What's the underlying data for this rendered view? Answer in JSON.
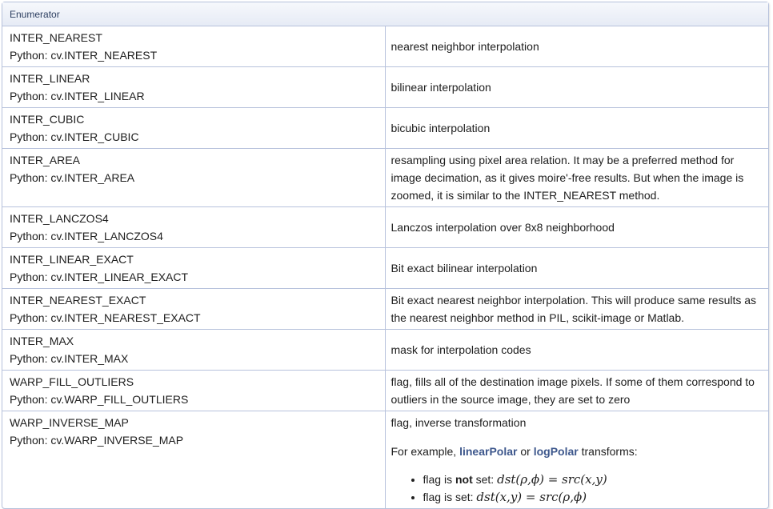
{
  "header": {
    "title": "Enumerator"
  },
  "rows": [
    {
      "name": "INTER_NEAREST",
      "python": "Python: cv.INTER_NEAREST",
      "desc": "nearest neighbor interpolation"
    },
    {
      "name": "INTER_LINEAR",
      "python": "Python: cv.INTER_LINEAR",
      "desc": "bilinear interpolation"
    },
    {
      "name": "INTER_CUBIC",
      "python": "Python: cv.INTER_CUBIC",
      "desc": "bicubic interpolation"
    },
    {
      "name": "INTER_AREA",
      "python": "Python: cv.INTER_AREA",
      "desc": "resampling using pixel area relation. It may be a preferred method for image decimation, as it gives moire'-free results. But when the image is zoomed, it is similar to the INTER_NEAREST method."
    },
    {
      "name": "INTER_LANCZOS4",
      "python": "Python: cv.INTER_LANCZOS4",
      "desc": "Lanczos interpolation over 8x8 neighborhood"
    },
    {
      "name": "INTER_LINEAR_EXACT",
      "python": "Python: cv.INTER_LINEAR_EXACT",
      "desc": "Bit exact bilinear interpolation"
    },
    {
      "name": "INTER_NEAREST_EXACT",
      "python": "Python: cv.INTER_NEAREST_EXACT",
      "desc": "Bit exact nearest neighbor interpolation. This will produce same results as the nearest neighbor method in PIL, scikit-image or Matlab."
    },
    {
      "name": "INTER_MAX",
      "python": "Python: cv.INTER_MAX",
      "desc": "mask for interpolation codes"
    },
    {
      "name": "WARP_FILL_OUTLIERS",
      "python": "Python: cv.WARP_FILL_OUTLIERS",
      "desc": "flag, fills all of the destination image pixels. If some of them correspond to outliers in the source image, they are set to zero"
    }
  ],
  "last_row": {
    "name": "WARP_INVERSE_MAP",
    "python": "Python: cv.WARP_INVERSE_MAP",
    "desc": "flag, inverse transformation",
    "example_prefix": "For example, ",
    "link1": "linearPolar",
    "example_mid": " or ",
    "link2": "logPolar",
    "example_suffix": " transforms:",
    "bullet1_prefix": "flag is ",
    "bullet1_bold": "not",
    "bullet1_mid": " set: ",
    "bullet1_math": "dst(ρ,ϕ) = src(x,y)",
    "bullet2_prefix": "flag is set: ",
    "bullet2_math": "dst(x,y) = src(ρ,ϕ)"
  },
  "colors": {
    "border": "#b7c2dc",
    "header_bg": "#e6ebf5",
    "link": "#3d578c"
  }
}
